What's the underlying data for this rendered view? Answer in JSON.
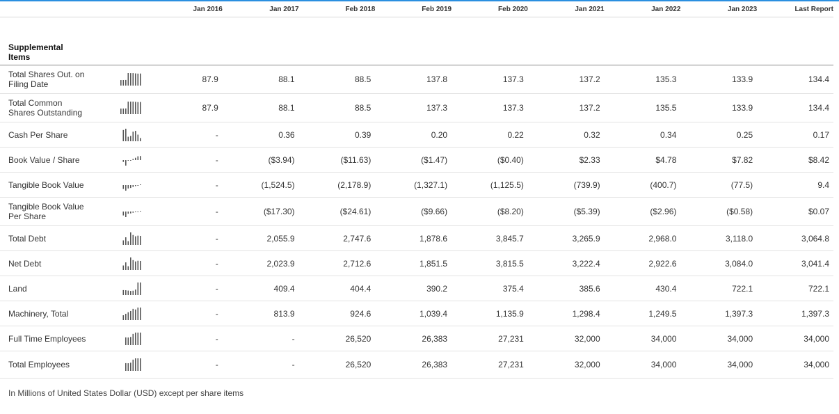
{
  "columns": [
    "Jan 2016",
    "Jan 2017",
    "Feb 2018",
    "Feb 2019",
    "Feb 2020",
    "Jan 2021",
    "Jan 2022",
    "Jan 2023",
    "Last Report"
  ],
  "section_title": "Supplemental Items",
  "rows": [
    {
      "label": "Total Shares Out. on Filing Date",
      "values": [
        "87.9",
        "88.1",
        "88.5",
        "137.8",
        "137.3",
        "137.2",
        "135.3",
        "133.9",
        "134.4"
      ],
      "trend": [
        87.9,
        88.1,
        88.5,
        137.8,
        137.3,
        137.2,
        135.3,
        133.9,
        134.4
      ]
    },
    {
      "label": "Total Common Shares Outstanding",
      "values": [
        "87.9",
        "88.1",
        "88.5",
        "137.3",
        "137.3",
        "137.2",
        "135.5",
        "133.9",
        "134.4"
      ],
      "trend": [
        87.9,
        88.1,
        88.5,
        137.3,
        137.3,
        137.2,
        135.5,
        133.9,
        134.4
      ]
    },
    {
      "label": "Cash Per Share",
      "values": [
        "-",
        "0.36",
        "0.39",
        "0.20",
        "0.22",
        "0.32",
        "0.34",
        "0.25",
        "0.17"
      ],
      "trend": [
        null,
        0.36,
        0.39,
        0.2,
        0.22,
        0.32,
        0.34,
        0.25,
        0.17
      ]
    },
    {
      "label": "Book Value / Share",
      "values": [
        "-",
        "($3.94)",
        "($11.63)",
        "($1.47)",
        "($0.40)",
        "$2.33",
        "$4.78",
        "$7.82",
        "$8.42"
      ],
      "trend": [
        null,
        -3.94,
        -11.63,
        -1.47,
        -0.4,
        2.33,
        4.78,
        7.82,
        8.42
      ]
    },
    {
      "label": "Tangible Book Value",
      "values": [
        "-",
        "(1,524.5)",
        "(2,178.9)",
        "(1,327.1)",
        "(1,125.5)",
        "(739.9)",
        "(400.7)",
        "(77.5)",
        "9.4"
      ],
      "trend": [
        null,
        -1524.5,
        -2178.9,
        -1327.1,
        -1125.5,
        -739.9,
        -400.7,
        -77.5,
        9.4
      ]
    },
    {
      "label": "Tangible Book Value Per Share",
      "values": [
        "-",
        "($17.30)",
        "($24.61)",
        "($9.66)",
        "($8.20)",
        "($5.39)",
        "($2.96)",
        "($0.58)",
        "$0.07"
      ],
      "trend": [
        null,
        -17.3,
        -24.61,
        -9.66,
        -8.2,
        -5.39,
        -2.96,
        -0.58,
        0.07
      ]
    },
    {
      "label": "Total Debt",
      "values": [
        "-",
        "2,055.9",
        "2,747.6",
        "1,878.6",
        "3,845.7",
        "3,265.9",
        "2,968.0",
        "3,118.0",
        "3,064.8"
      ],
      "trend": [
        null,
        2055.9,
        2747.6,
        1878.6,
        3845.7,
        3265.9,
        2968.0,
        3118.0,
        3064.8
      ]
    },
    {
      "label": "Net Debt",
      "values": [
        "-",
        "2,023.9",
        "2,712.6",
        "1,851.5",
        "3,815.5",
        "3,222.4",
        "2,922.6",
        "3,084.0",
        "3,041.4"
      ],
      "trend": [
        null,
        2023.9,
        2712.6,
        1851.5,
        3815.5,
        3222.4,
        2922.6,
        3084.0,
        3041.4
      ]
    },
    {
      "label": "Land",
      "values": [
        "-",
        "409.4",
        "404.4",
        "390.2",
        "375.4",
        "385.6",
        "430.4",
        "722.1",
        "722.1"
      ],
      "trend": [
        null,
        409.4,
        404.4,
        390.2,
        375.4,
        385.6,
        430.4,
        722.1,
        722.1
      ]
    },
    {
      "label": "Machinery, Total",
      "values": [
        "-",
        "813.9",
        "924.6",
        "1,039.4",
        "1,135.9",
        "1,298.4",
        "1,249.5",
        "1,397.3",
        "1,397.3"
      ],
      "trend": [
        null,
        813.9,
        924.6,
        1039.4,
        1135.9,
        1298.4,
        1249.5,
        1397.3,
        1397.3
      ]
    },
    {
      "label": "Full Time Employees",
      "values": [
        "-",
        "-",
        "26,520",
        "26,383",
        "27,231",
        "32,000",
        "34,000",
        "34,000",
        "34,000"
      ],
      "trend": [
        null,
        null,
        26520,
        26383,
        27231,
        32000,
        34000,
        34000,
        34000
      ]
    },
    {
      "label": "Total Employees",
      "values": [
        "-",
        "-",
        "26,520",
        "26,383",
        "27,231",
        "32,000",
        "34,000",
        "34,000",
        "34,000"
      ],
      "trend": [
        null,
        null,
        26520,
        26383,
        27231,
        32000,
        34000,
        34000,
        34000
      ]
    }
  ],
  "footnote": "In Millions of United States Dollar (USD) except per share items"
}
